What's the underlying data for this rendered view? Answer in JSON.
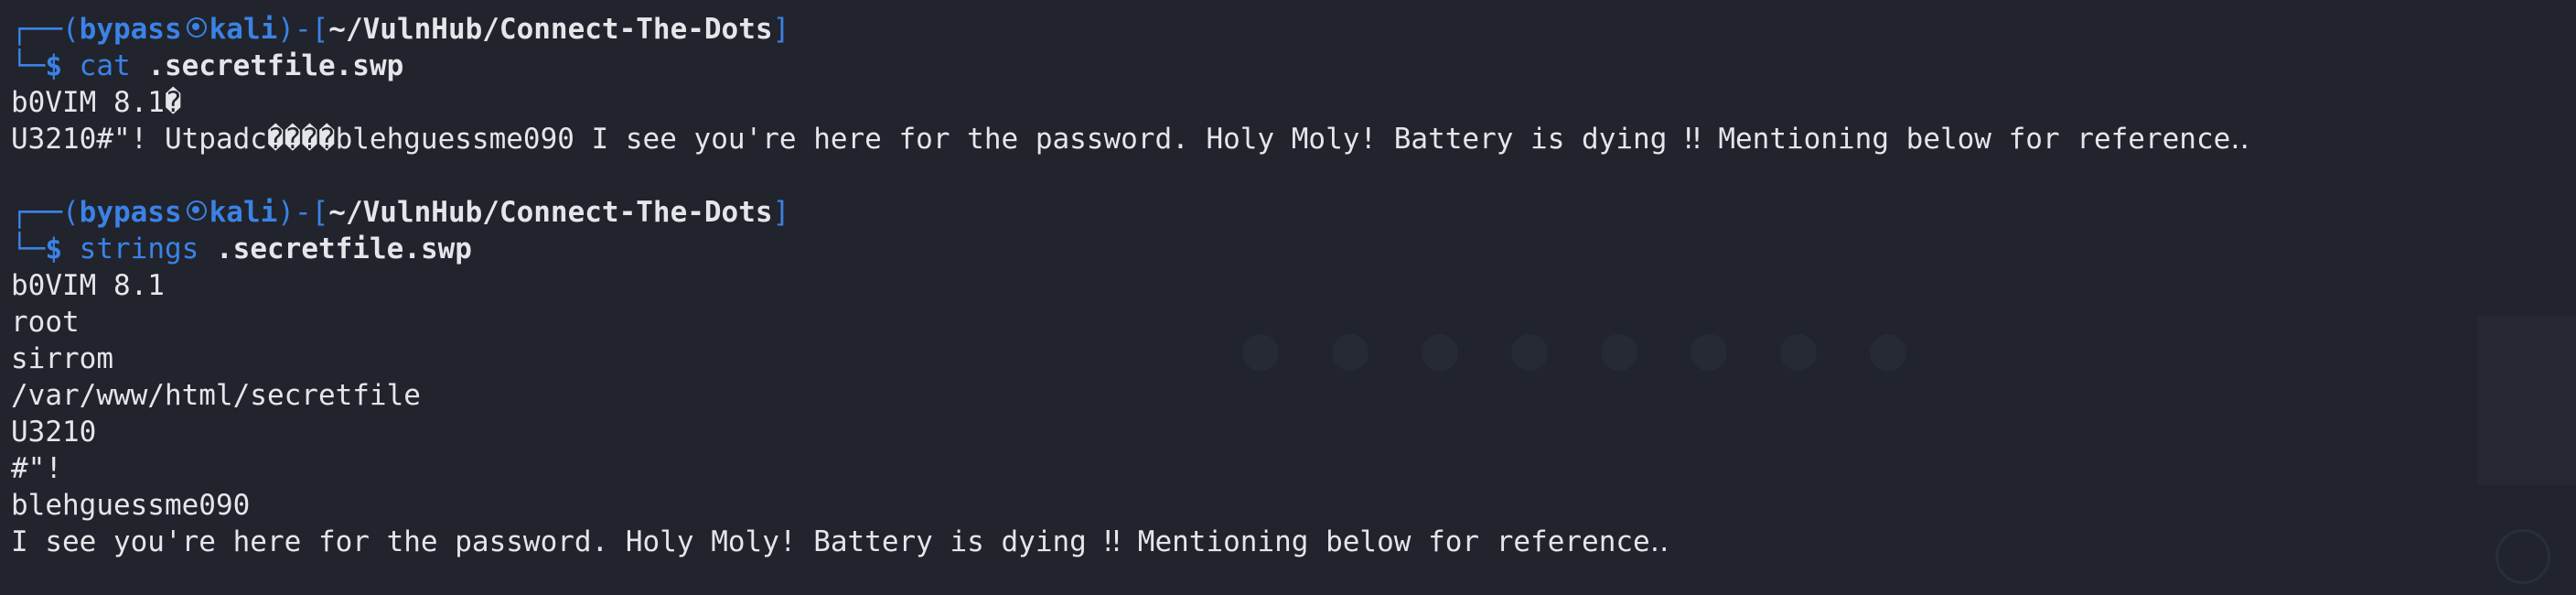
{
  "colors": {
    "background": "#21242c",
    "prompt_blue": "#3b82e6",
    "text": "#e4e6ea"
  },
  "prompt": {
    "frame_top": "┌──(",
    "user": "bypass",
    "skull_icon": "skull-icon",
    "host": "kali",
    "close_paren": ")",
    "dash_bracket_open": "-[",
    "path": "~/VulnHub/Connect-The-Dots",
    "bracket_close": "]",
    "frame_bottom": "└─",
    "dollar": "$"
  },
  "blocks": [
    {
      "command": "cat",
      "argument": ".secretfile.swp",
      "output": [
        "b0VIM 8.1�",
        "U3210#\"! Utpadc����blehguessme090 I see you're here for the password. Holy Moly! Battery is dying ‼ Mentioning below for reference‥"
      ]
    },
    {
      "command": "strings",
      "argument": ".secretfile.swp",
      "output": [
        "b0VIM 8.1",
        "root",
        "sirrom",
        "/var/www/html/secretfile",
        "U3210",
        "#\"!",
        "blehguessme090",
        "I see you're here for the password. Holy Moly! Battery is dying ‼ Mentioning below for reference‥"
      ]
    }
  ]
}
